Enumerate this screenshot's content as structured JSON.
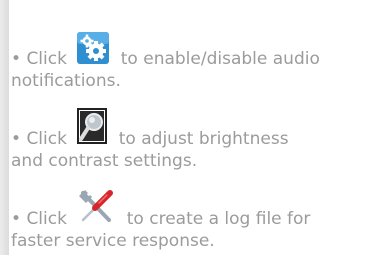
{
  "help_items": [
    {
      "bullet": "•",
      "verb": "Click",
      "icon": "settings-gears-icon",
      "text_line1": "to enable/disable audio",
      "text_line2": "notifications."
    },
    {
      "bullet": "•",
      "verb": "Click",
      "icon": "magnifier-icon",
      "text_line1": "to adjust brightness",
      "text_line2": "and contrast settings."
    },
    {
      "bullet": "•",
      "verb": "Click",
      "icon": "tools-screwdriver-wrench-icon",
      "text_line1": "to create a log file for",
      "text_line2": "faster service response."
    }
  ],
  "colors": {
    "text": "#9b9b9b",
    "gear_bg": "#2f8fd0",
    "gear_fill": "#ffffff",
    "magnifier_frame": "#111111",
    "screwdriver_handle": "#d6262b",
    "wrench_metal": "#9aa7b2"
  }
}
